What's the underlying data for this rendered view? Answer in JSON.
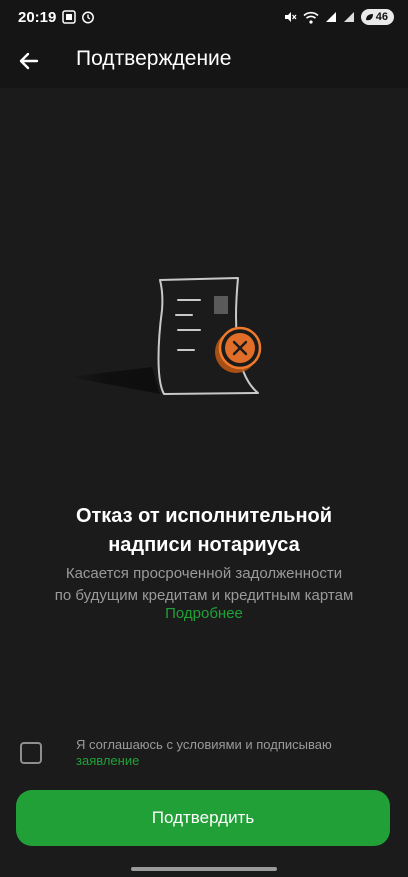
{
  "status": {
    "time": "20:19",
    "battery": "46",
    "icons": [
      "screenshot-icon",
      "alarm-icon",
      "mute-icon",
      "wifi-icon",
      "signal-icon",
      "signal-icon-2"
    ]
  },
  "header": {
    "back_icon": "arrow-left-icon",
    "title": "Подтверждение"
  },
  "main": {
    "illustration": "document-rejected-icon",
    "heading_line1": "Отказ от исполнительной",
    "heading_line2": "надписи нотариуса",
    "subtitle_line1": "Касается просроченной задолженности",
    "subtitle_line2": "по будущим кредитам и кредитным картам",
    "more_link": "Подробнее"
  },
  "agreement": {
    "checked": false,
    "text": "Я соглашаюсь с условиями и подписываю",
    "link": "заявление"
  },
  "footer": {
    "confirm_label": "Подтвердить"
  },
  "colors": {
    "accent": "#21a038",
    "background": "#1b1b1b",
    "reject_badge": "#f07a2b"
  }
}
